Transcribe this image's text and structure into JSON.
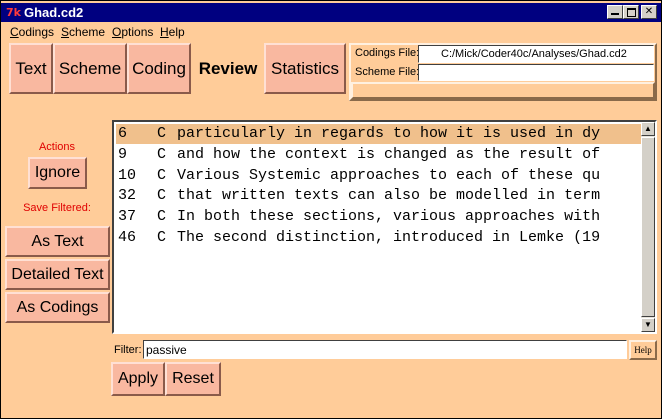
{
  "window": {
    "title": "Ghad.cd2",
    "icon_glyph": "7k",
    "icon_name": "tk-app-icon"
  },
  "menu": [
    {
      "label": "Codings"
    },
    {
      "label": "Scheme"
    },
    {
      "label": "Options"
    },
    {
      "label": "Help"
    }
  ],
  "tabs": {
    "text": "Text",
    "scheme": "Scheme",
    "coding": "Coding",
    "review": "Review",
    "statistics": "Statistics"
  },
  "files": {
    "codings_label": "Codings File:",
    "codings_value": "C:/Mick/Coder40c/Analyses/Ghad.cd2",
    "scheme_label": "Scheme File:",
    "scheme_value": ""
  },
  "sidebar": {
    "actions_label": "Actions",
    "ignore_label": "Ignore",
    "save_filtered_label": "Save Filtered:",
    "as_text_label": "As Text",
    "detailed_text_label": "Detailed Text",
    "as_codings_label": "As Codings"
  },
  "results": [
    {
      "num": "6",
      "code": "C",
      "text": "particularly in regards to how it is used in dy"
    },
    {
      "num": "9",
      "code": "C",
      "text": "and how the context is changed as the result of"
    },
    {
      "num": "10",
      "code": "C",
      "text": "Various Systemic approaches to each of these qu"
    },
    {
      "num": "32",
      "code": "C",
      "text": "that written texts can also be modelled in term"
    },
    {
      "num": "37",
      "code": "C",
      "text": "In both these sections, various approaches with"
    },
    {
      "num": "46",
      "code": "C",
      "text": "The second distinction, introduced in Lemke (19"
    }
  ],
  "filter": {
    "label": "Filter:",
    "value": "passive",
    "help_label": "Help"
  },
  "buttons": {
    "apply": "Apply",
    "reset": "Reset"
  },
  "colors": {
    "title_bar": "#000080",
    "background": "#ffcc99",
    "button_face": "#f9b8a0",
    "selected_row": "#f0c08c",
    "red_label": "#e00000"
  }
}
